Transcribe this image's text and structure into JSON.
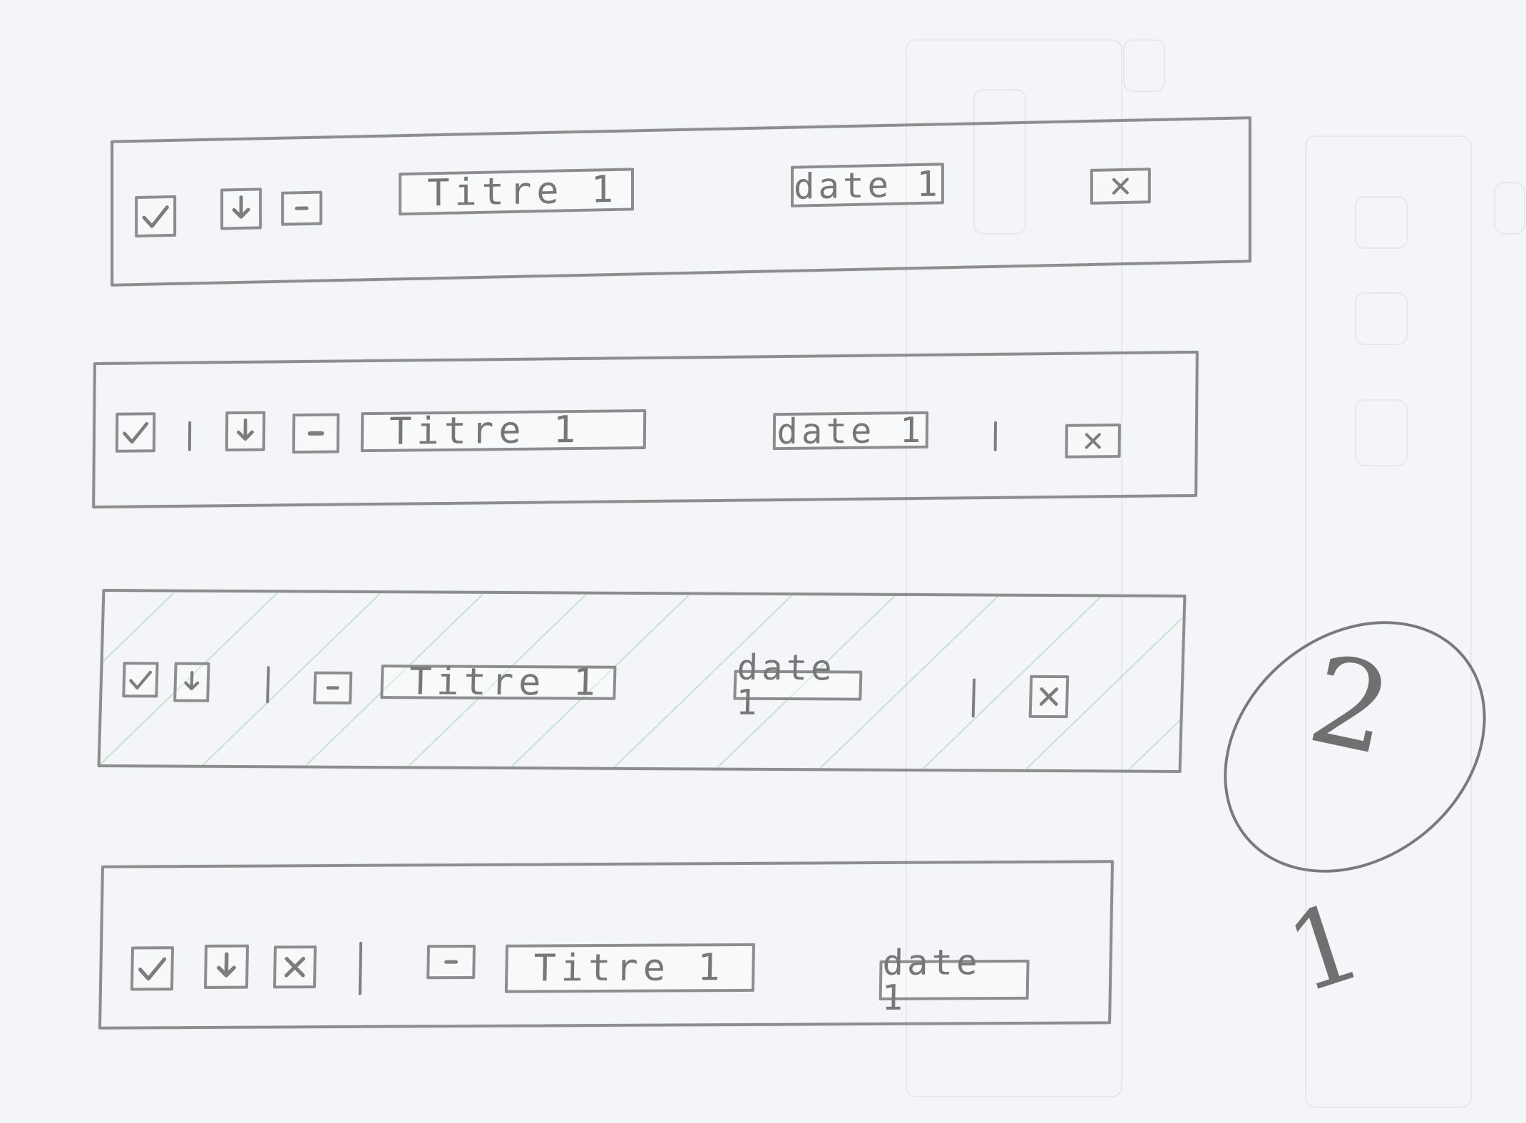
{
  "sketch": {
    "rows": [
      {
        "title": "Titre 1",
        "date": "date 1"
      },
      {
        "title": "Titre 1",
        "date": "date 1"
      },
      {
        "title": "Titre 1",
        "date": "date 1"
      },
      {
        "title": "Titre 1",
        "date": "date 1"
      }
    ],
    "annotations": {
      "circle_number": "2",
      "side_number": "1"
    }
  },
  "icons": {
    "checkbox": "check-icon",
    "download": "download-icon",
    "minus": "minus-icon",
    "close": "close-icon"
  },
  "colors": {
    "paper": "#f4f5f8",
    "pencil": "#8d8d8d",
    "hatch": "#3caa64"
  }
}
